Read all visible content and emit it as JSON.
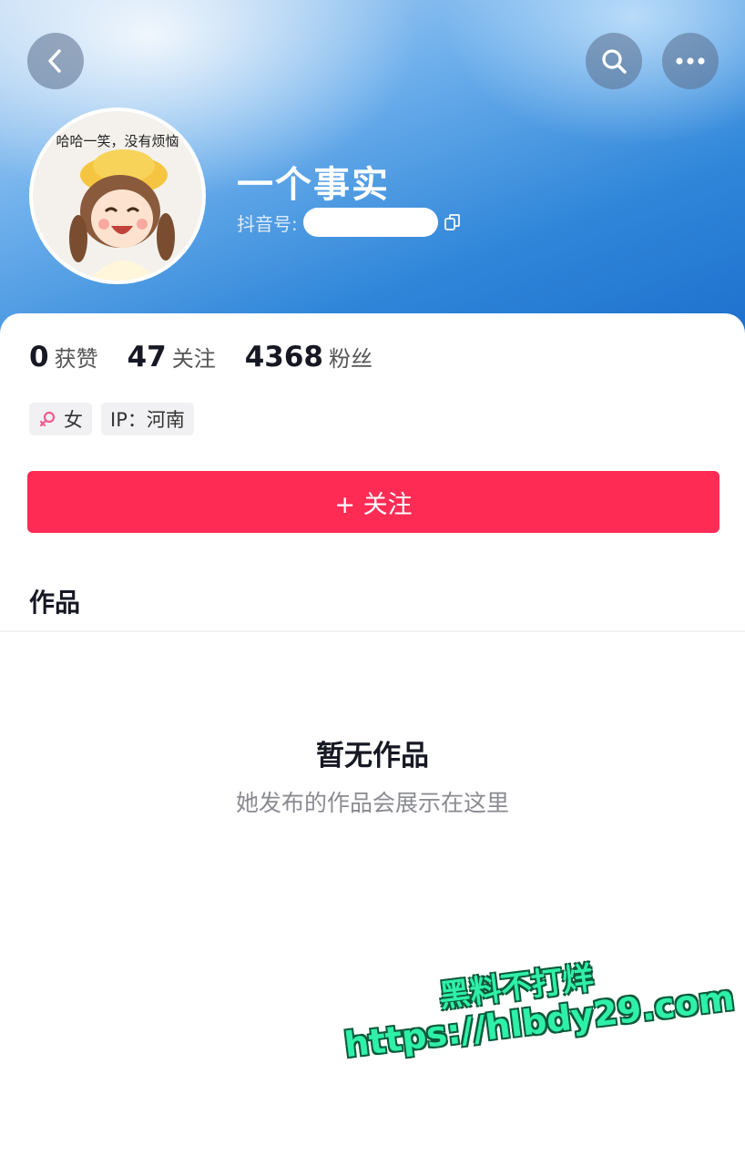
{
  "header": {
    "icons": {
      "back": "chevron-left-icon",
      "search": "search-icon",
      "more": "more-dots-icon"
    }
  },
  "profile": {
    "avatar_caption": "哈哈一笑，没有烦恼",
    "nickname": "一个事实",
    "douyin_id_label": "抖音号:",
    "copy_icon": "copy-icon"
  },
  "stats": [
    {
      "value": "0",
      "label": "获赞"
    },
    {
      "value": "47",
      "label": "关注"
    },
    {
      "value": "4368",
      "label": "粉丝"
    }
  ],
  "tags": {
    "gender": "女",
    "ip": "IP：河南"
  },
  "follow_button": {
    "label": "+ 关注",
    "color": "#fe2c55"
  },
  "works": {
    "section_title": "作品",
    "empty_title": "暂无作品",
    "empty_subtitle": "她发布的作品会展示在这里"
  },
  "watermark": {
    "line1": "黑料不打烊",
    "line2": "https://hlbdy29.com"
  }
}
